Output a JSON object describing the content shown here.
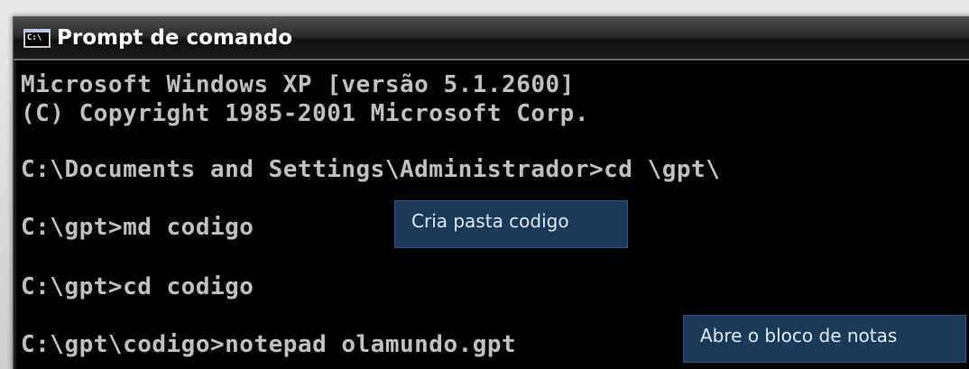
{
  "window": {
    "icon_text": "C:\\",
    "title": "Prompt de comando"
  },
  "console": {
    "lines": [
      "Microsoft Windows XP [versão 5.1.2600]",
      "(C) Copyright 1985-2001 Microsoft Corp.",
      "C:\\Documents and Settings\\Administrador>cd \\gpt\\",
      "C:\\gpt>md codigo",
      "C:\\gpt>cd codigo",
      "C:\\gpt\\codigo>notepad olamundo.gpt"
    ]
  },
  "annotations": {
    "create_folder": "Cria pasta codigo",
    "open_notepad": "Abre o bloco de notas"
  },
  "colors": {
    "console_bg": "#000000",
    "console_text": "#c0c0c0",
    "callout_bg": "#1b3a59",
    "callout_text": "#dfe9f3"
  }
}
